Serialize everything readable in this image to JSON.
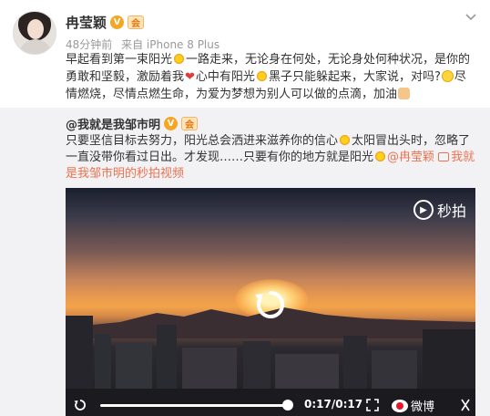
{
  "post": {
    "username": "冉莹颖",
    "vip_mark": "V",
    "badge": "会",
    "time": "48分钟前",
    "source": "来自 iPhone 8 Plus",
    "text_parts": [
      "早起看到第一束阳光",
      "一路走来，无论身在何处，无论身处何种状况，是你的勇敢和坚毅，激励着我",
      "心中有阳光",
      "黑子只能躲起来，大家说，对吗?",
      "尽情燃烧，尽情点燃生命，为爱为梦想为别人可以做的点滴，加油"
    ]
  },
  "repost": {
    "username": "@我就是我邹市明",
    "vip_mark": "V",
    "badge": "会",
    "text_parts": [
      "只要坚信目标去努力，阳光总会洒进来滋养你的信心",
      "太阳冒出头时，忽略了一直没带你看过日出。才发现……只要有你的地方就是阳光",
      "@冉莹颖",
      "我就是我邹市明的秒拍视频"
    ]
  },
  "video": {
    "watermark": "秒拍",
    "time": "0:17/0:17",
    "progress": 1.0,
    "brand": "微博"
  },
  "icons": {
    "chevron": "chevron-down-icon",
    "replay": "replay-icon",
    "fullscreen": "fullscreen-icon",
    "close": "close-icon"
  },
  "colors": {
    "link": "#eb7350",
    "repost_bg": "#f2f2f5",
    "vip": "#f5a623"
  }
}
